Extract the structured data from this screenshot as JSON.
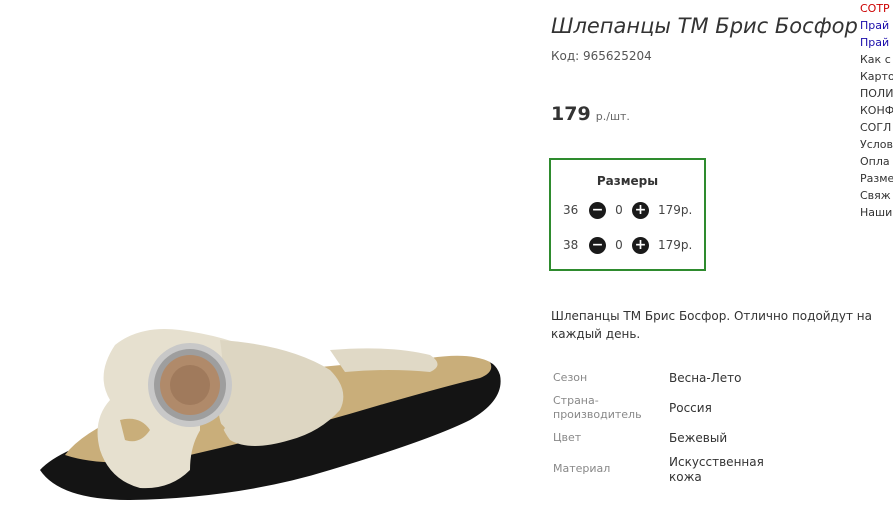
{
  "product": {
    "title": "Шлепанцы ТМ Брис Босфор",
    "code": "Код: 965625204",
    "price": "179",
    "price_unit": "р./шт.",
    "description": "Шлепанцы ТМ Брис Босфор. Отлично подойдут на каждый день."
  },
  "sizes": {
    "title": "Размеры",
    "rows": [
      {
        "size": "36",
        "qty": "0",
        "price": "179р."
      },
      {
        "size": "38",
        "qty": "0",
        "price": "179р."
      }
    ],
    "minus_icon": "minus-circle-icon",
    "plus_icon": "plus-circle-icon"
  },
  "attributes": [
    {
      "key": "Сезон",
      "value": "Весна-Лето"
    },
    {
      "key": "Страна-производитель",
      "value": "Россия"
    },
    {
      "key": "Цвет",
      "value": "Бежевый"
    },
    {
      "key": "Материал",
      "value": "Искусственная кожа"
    }
  ],
  "side_menu": [
    {
      "label": "СОТР",
      "color": "#cc0000"
    },
    {
      "label": "Прай",
      "color": "#1a0dab"
    },
    {
      "label": "Прай",
      "color": "#1a0dab"
    },
    {
      "label": "Как с",
      "color": "#333333"
    },
    {
      "label": "Карто",
      "color": "#333333"
    },
    {
      "label": "ПОЛИ",
      "color": "#333333"
    },
    {
      "label": "КОНФ",
      "color": "#333333"
    },
    {
      "label": "СОГЛ",
      "color": "#333333"
    },
    {
      "label": "Услов",
      "color": "#333333"
    },
    {
      "label": "Опла",
      "color": "#333333"
    },
    {
      "label": "Разме",
      "color": "#333333"
    },
    {
      "label": "Свяж",
      "color": "#333333"
    },
    {
      "label": "Наши",
      "color": "#333333"
    }
  ],
  "colors": {
    "sizes_border": "#2e8b2e",
    "product_beige": "#e6e0cf"
  }
}
